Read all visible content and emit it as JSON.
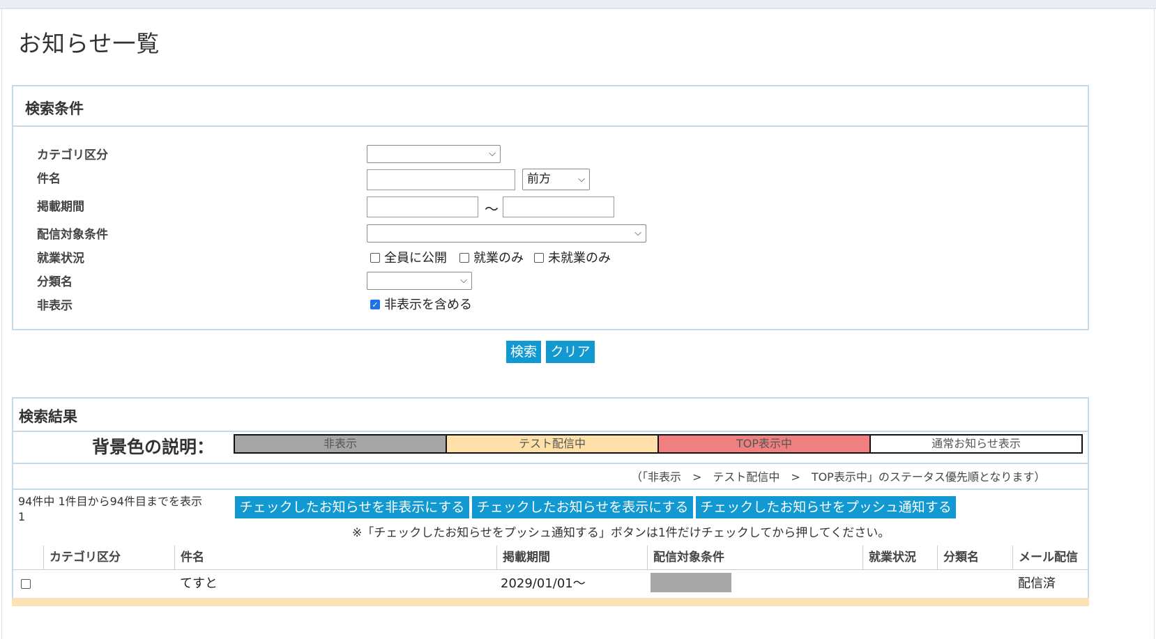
{
  "page": {
    "title": "お知らせ一覧"
  },
  "search_panel": {
    "header": "検索条件",
    "fields": {
      "category_label": "カテゴリ区分",
      "category_value": "",
      "subject_label": "件名",
      "subject_value": "",
      "subject_match_value": "前方",
      "period_label": "掲載期間",
      "period_from": "",
      "period_tilde": "～",
      "period_to": "",
      "target_label": "配信対象条件",
      "target_value": "",
      "employment_label": "就業状況",
      "employment_options": [
        {
          "label": "全員に公開",
          "checked": false
        },
        {
          "label": "就業のみ",
          "checked": false
        },
        {
          "label": "未就業のみ",
          "checked": false
        }
      ],
      "classification_label": "分類名",
      "classification_value": "",
      "hidden_label": "非表示",
      "hidden_include_label": "非表示を含める",
      "hidden_include_checked": true
    },
    "search_button": "検索",
    "clear_button": "クリア"
  },
  "results_panel": {
    "header": "検索結果",
    "legend_label": "背景色の説明：",
    "legend": [
      {
        "label": "非表示",
        "color": "#a6a6a6"
      },
      {
        "label": "テスト配信中",
        "color": "#ffe0a8"
      },
      {
        "label": "TOP表示中",
        "color": "#f08080"
      },
      {
        "label": "通常お知らせ表示",
        "color": "#ffffff"
      }
    ],
    "priority_note": "（「非表示　>　テスト配信中　>　TOP表示中」のステータス優先順となります）",
    "count_text": "94件中 1件目から94件目までを表示",
    "page_number": "1",
    "actions": {
      "hide_button": "チェックしたお知らせを非表示にする",
      "show_button": "チェックしたお知らせを表示にする",
      "push_button": "チェックしたお知らせをプッシュ通知する"
    },
    "push_note": "※「チェックしたお知らせをプッシュ通知する」ボタンは1件だけチェックしてから押してください。",
    "columns": [
      "カテゴリ区分",
      "件名",
      "掲載期間",
      "配信対象条件",
      "就業状況",
      "分類名",
      "メール配信"
    ],
    "rows": [
      {
        "checked": false,
        "category": "",
        "subject": "てすと",
        "period": "2029/01/01～",
        "target": "",
        "employment": "",
        "classification": "",
        "mail": "配信済"
      }
    ]
  }
}
